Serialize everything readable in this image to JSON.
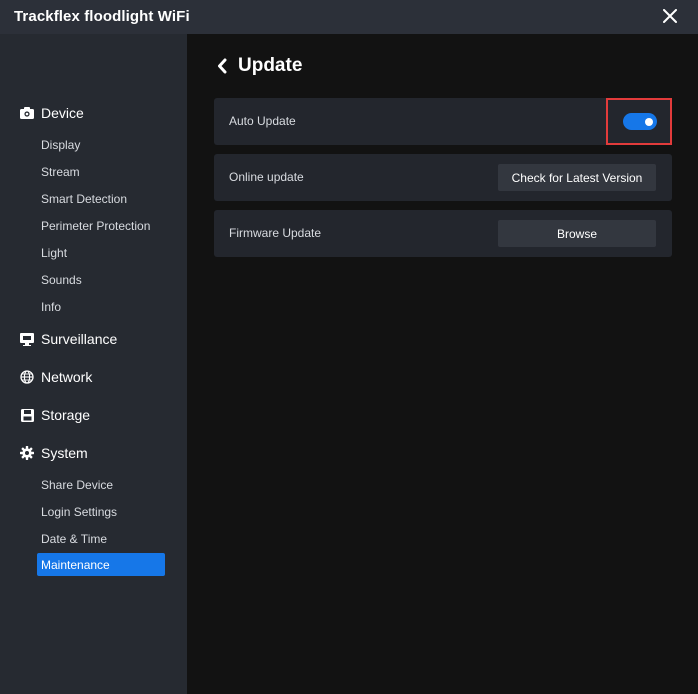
{
  "app": {
    "title": "Trackflex floodlight WiFi"
  },
  "sidebar": {
    "device": {
      "label": "Device",
      "items": [
        "Display",
        "Stream",
        "Smart Detection",
        "Perimeter Protection",
        "Light",
        "Sounds",
        "Info"
      ]
    },
    "surveillance": {
      "label": "Surveillance"
    },
    "network": {
      "label": "Network"
    },
    "storage": {
      "label": "Storage"
    },
    "system": {
      "label": "System",
      "items": [
        "Share Device",
        "Login Settings",
        "Date & Time",
        "Maintenance"
      ],
      "active": "Maintenance"
    }
  },
  "main": {
    "title": "Update",
    "rows": [
      {
        "label": "Auto Update",
        "toggle_on": true
      },
      {
        "label": "Online update",
        "button": "Check for Latest Version"
      },
      {
        "label": "Firmware Update",
        "button": "Browse"
      }
    ]
  },
  "colors": {
    "accent": "#1677e8",
    "highlight": "#e23b3b",
    "sidebar": "#262a31",
    "titlebar": "#2c3039"
  }
}
